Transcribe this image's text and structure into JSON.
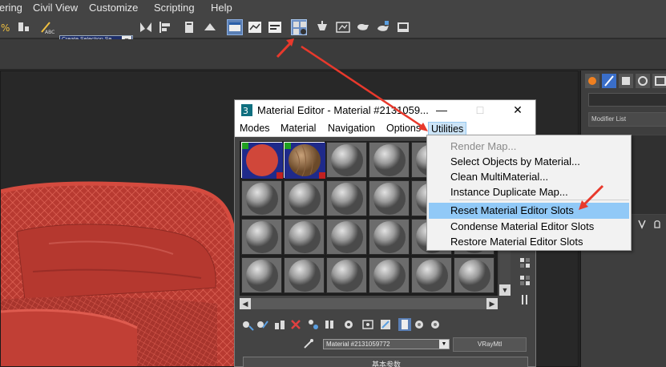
{
  "app": {
    "menu": [
      "ering",
      "Civil View",
      "Customize",
      "Scripting",
      "Help"
    ],
    "selection_set_placeholder": "Create Selection Se",
    "modifier_list_label": "Modifier List"
  },
  "material_editor": {
    "title": "Material Editor - Material #2131059...",
    "window_buttons": {
      "minimize": "—",
      "maximize": "□",
      "close": "✕"
    },
    "menus": [
      "Modes",
      "Material",
      "Navigation",
      "Options",
      "Utilities"
    ],
    "active_menu": "Utilities",
    "material_name": "Material #2131059772",
    "material_type": "VRayMtl",
    "rollout_title": "基本参数"
  },
  "utilities_menu": {
    "items": [
      {
        "label": "Render Map...",
        "enabled": false
      },
      {
        "label": "Select Objects by Material...",
        "enabled": true
      },
      {
        "label": "Clean MultiMaterial...",
        "enabled": true
      },
      {
        "label": "Instance Duplicate Map...",
        "enabled": true
      },
      {
        "label": "Reset Material Editor Slots",
        "enabled": true,
        "highlighted": true
      },
      {
        "label": "Condense Material Editor Slots",
        "enabled": true
      },
      {
        "label": "Restore Material Editor Slots",
        "enabled": true
      }
    ]
  },
  "colors": {
    "highlight": "#91c9f7",
    "annotation_arrow": "#e8392c",
    "chair": "#c8433a",
    "slot_sphere_gray": "#9a9a9a"
  }
}
